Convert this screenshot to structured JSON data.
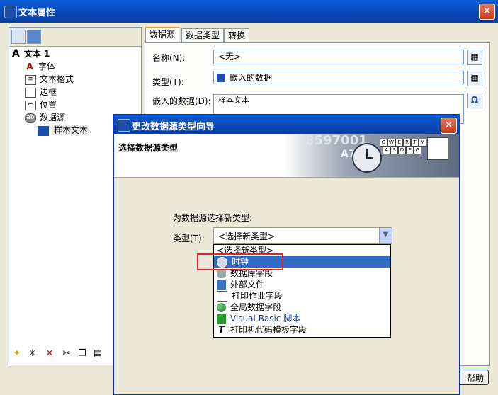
{
  "window": {
    "title": "文本属性",
    "close": "✕"
  },
  "tree": {
    "root": "文本 1",
    "items": [
      "字体",
      "文本格式",
      "边框",
      "位置",
      "数据源"
    ],
    "child": "样本文本"
  },
  "tabs": [
    "数据源",
    "数据类型",
    "转换"
  ],
  "form": {
    "name_label": "名称(N):",
    "name_value": "<无>",
    "type_label": "类型(T):",
    "type_value": "嵌入的数据",
    "embedded_label": "嵌入的数据(D):",
    "embedded_value": "样本文本"
  },
  "wizard": {
    "title": "更改数据源类型向导",
    "header": "选择数据源类型",
    "prompt": "为数据源选择新类型:",
    "type_label": "类型(T):",
    "combo_value": "<选择新类型>",
    "options": [
      "<选择新类型>",
      "时钟",
      "数据库字段",
      "外部文件",
      "打印作业字段",
      "全局数据字段",
      "Visual Basic 脚本",
      "打印机代码模板字段"
    ],
    "selected_index": 1,
    "banner_text": [
      "8597001",
      "A7-118"
    ],
    "keys": [
      "Q",
      "W",
      "E",
      "R",
      "T",
      "Y",
      "A",
      "S",
      "D",
      "F",
      "G"
    ]
  },
  "help_button": "帮助",
  "colors": {
    "title_blue": "#0747b8",
    "selection": "#316ac5",
    "highlight_box": "#e0232a"
  }
}
